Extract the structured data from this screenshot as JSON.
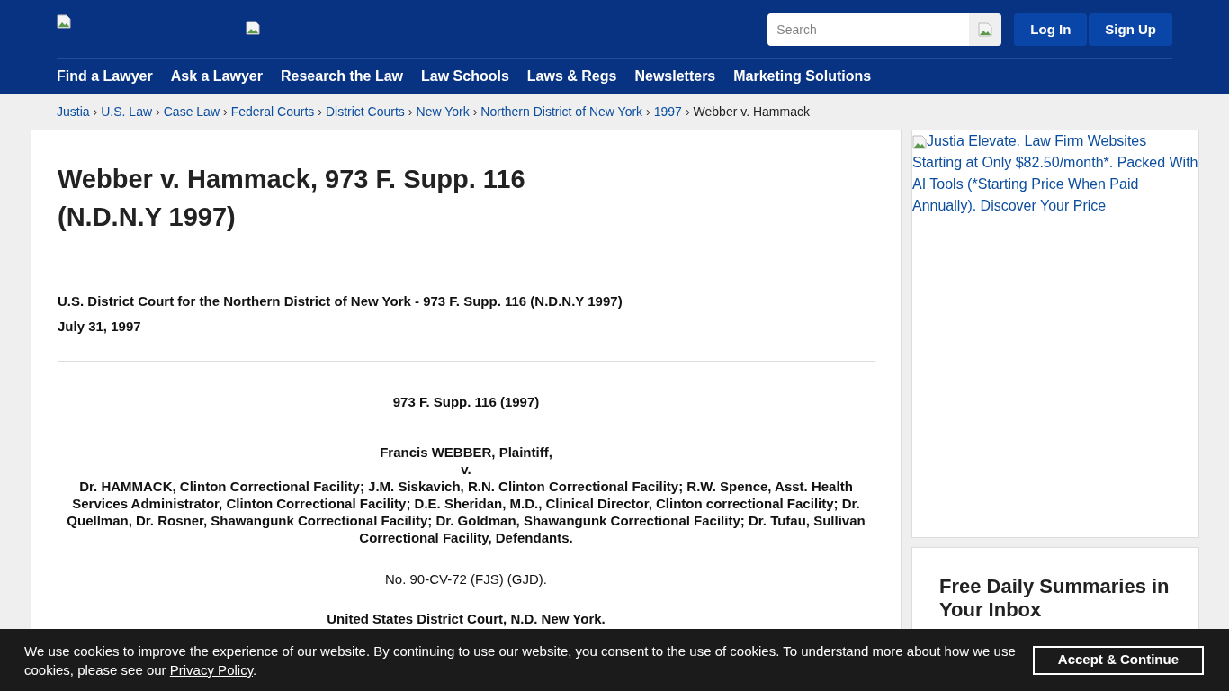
{
  "header": {
    "search": {
      "placeholder": "Search"
    },
    "buttons": [
      "Log In",
      "Sign Up"
    ],
    "nav": [
      "Find a Lawyer",
      "Ask a Lawyer",
      "Research the Law",
      "Law Schools",
      "Laws & Regs",
      "Newsletters",
      "Marketing Solutions"
    ]
  },
  "breadcrumb_separator": "›",
  "breadcrumbs": [
    {
      "label": "Justia",
      "link": true
    },
    {
      "label": "U.S. Law",
      "link": true
    },
    {
      "label": "Case Law",
      "link": true
    },
    {
      "label": "Federal Courts",
      "link": true
    },
    {
      "label": "District Courts",
      "link": true
    },
    {
      "label": "New York",
      "link": true
    },
    {
      "label": "Northern District of New York",
      "link": true
    },
    {
      "label": "1997",
      "link": true
    },
    {
      "label": "Webber v. Hammack",
      "link": false
    }
  ],
  "case": {
    "title": "Webber v. Hammack, 973 F. Supp. 116 (N.D.N.Y 1997)",
    "court": "U.S. District Court for the Northern District of New York - 973 F. Supp. 116 (N.D.N.Y 1997)",
    "date": "July 31, 1997",
    "body": [
      {
        "kind": "bold",
        "text": "973 F. Supp. 116 (1997)"
      },
      {
        "kind": "parties",
        "lines": [
          "Francis WEBBER, Plaintiff,",
          "v.",
          "Dr. HAMMACK, Clinton Correctional Facility; J.M. Siskavich, R.N. Clinton Correctional Facility; R.W. Spence, Asst. Health Services Administrator, Clinton Correctional Facility; D.E. Sheridan, M.D., Clinical Director, Clinton correctional Facility; Dr. Quellman, Dr. Rosner, Shawangunk Correctional Facility; Dr. Goldman, Shawangunk Correctional Facility; Dr. Tufau, Sullivan Correctional Facility, Defendants."
        ]
      },
      {
        "kind": "plain",
        "text": "No. 90-CV-72 (FJS) (GJD)."
      },
      {
        "kind": "bold",
        "text": "United States District Court, N.D. New York."
      }
    ]
  },
  "sidebar": {
    "ad_alt": "Justia Elevate. Law Firm Websites Starting at Only $82.50/month*. Packed With AI Tools (*Starting Price When Paid Annually). Discover Your Price",
    "newsletter_title": "Free Daily Summaries in Your Inbox"
  },
  "cookie_banner": {
    "text_before": "We use cookies to improve the experience of our website. By continuing to use our website, you consent to the use of cookies. To understand more about how we use cookies, please see our",
    "link": "Privacy Policy",
    "text_after": ".",
    "button": "Accept & Continue"
  }
}
